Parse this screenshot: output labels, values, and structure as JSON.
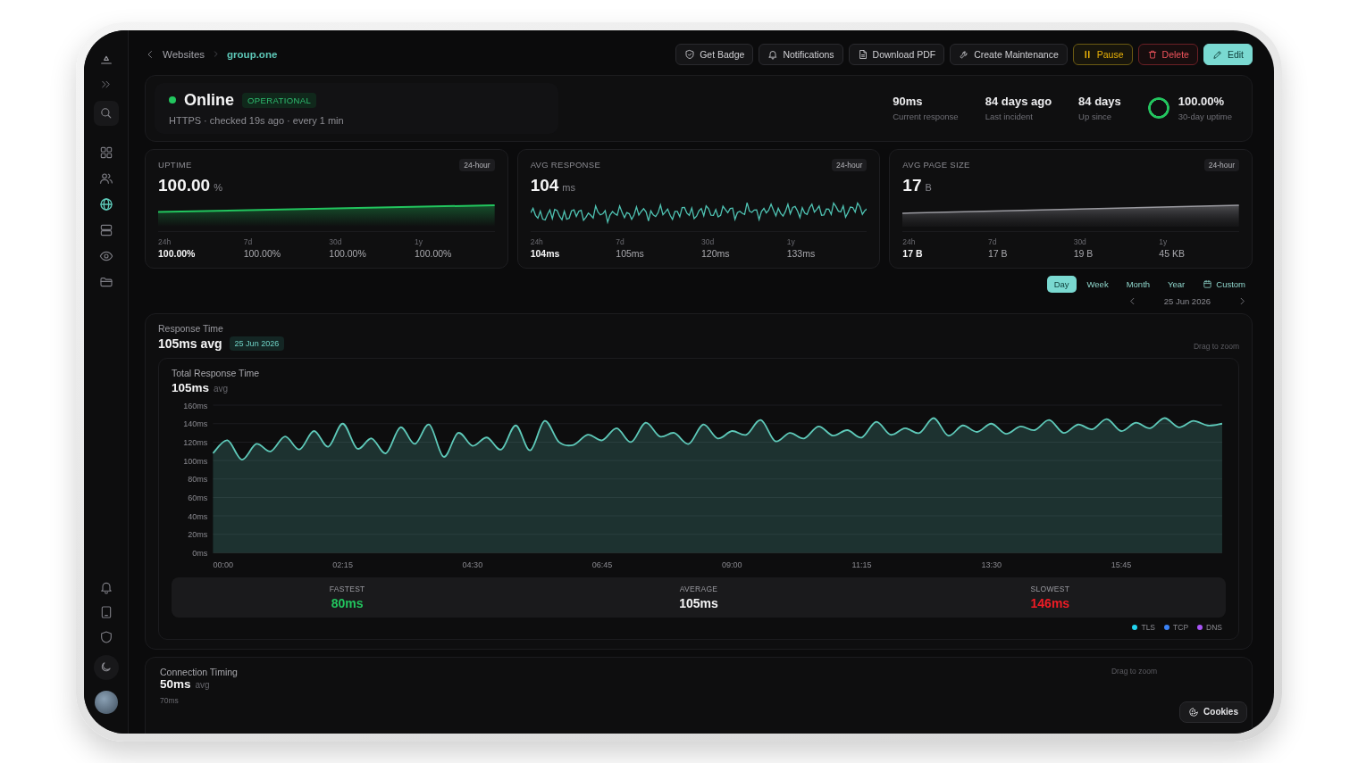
{
  "sidebar": {
    "nav": [
      {
        "selected": false
      },
      {
        "selected": false
      },
      {
        "selected": true
      },
      {
        "selected": false
      },
      {
        "selected": false
      },
      {
        "selected": false
      }
    ]
  },
  "breadcrumb": [
    {
      "label": "Websites",
      "current": false
    },
    {
      "label": "group.one",
      "current": true
    }
  ],
  "toolbar": [
    {
      "label": "Get Badge",
      "kind": "default"
    },
    {
      "label": "Notifications",
      "kind": "default"
    },
    {
      "label": "Download PDF",
      "kind": "default"
    },
    {
      "label": "Create Maintenance",
      "kind": "default"
    },
    {
      "label": "Pause",
      "kind": "warning"
    },
    {
      "label": "Delete",
      "kind": "danger"
    },
    {
      "label": "Edit",
      "kind": "primary"
    }
  ],
  "status": {
    "label": "Online",
    "online": true,
    "badge": "OPERATIONAL",
    "detail": "HTTPS · checked 19s ago · every 1 min"
  },
  "stats": [
    {
      "value": "90ms",
      "label": "Current response"
    },
    {
      "value": "84 days ago",
      "label": "Last incident"
    },
    {
      "value": "84 days",
      "label": "Up since"
    }
  ],
  "uptime_ring": {
    "value": "100.00%",
    "label": "30-day uptime",
    "level": 1
  },
  "cards": [
    {
      "kind": "uptime",
      "title": "UPTIME",
      "range": "24-hour",
      "value": "100.00",
      "unit": "%",
      "periods": [
        {
          "label": "24h",
          "value": "100.00%",
          "selected": true
        },
        {
          "label": "7d",
          "value": "100.00%",
          "selected": false
        },
        {
          "label": "30d",
          "value": "100.00%",
          "selected": false
        },
        {
          "label": "1y",
          "value": "100.00%",
          "selected": false
        }
      ]
    },
    {
      "kind": "response",
      "title": "AVG RESPONSE",
      "range": "24-hour",
      "value": "104",
      "unit": "ms",
      "periods": [
        {
          "label": "24h",
          "value": "104ms",
          "selected": true
        },
        {
          "label": "7d",
          "value": "105ms",
          "selected": false
        },
        {
          "label": "30d",
          "value": "120ms",
          "selected": false
        },
        {
          "label": "1y",
          "value": "133ms",
          "selected": false
        }
      ]
    },
    {
      "kind": "size",
      "title": "AVG PAGE SIZE",
      "range": "24-hour",
      "value": "17",
      "unit": "B",
      "periods": [
        {
          "label": "24h",
          "value": "17 B",
          "selected": true
        },
        {
          "label": "7d",
          "value": "17 B",
          "selected": false
        },
        {
          "label": "30d",
          "value": "19 B",
          "selected": false
        },
        {
          "label": "1y",
          "value": "45 KB",
          "selected": false
        }
      ]
    }
  ],
  "range_tabs": [
    {
      "label": "Day",
      "kind": "preset",
      "selected": true
    },
    {
      "label": "Week",
      "kind": "preset",
      "selected": false
    },
    {
      "label": "Month",
      "kind": "preset",
      "selected": false
    },
    {
      "label": "Year",
      "kind": "preset",
      "selected": false
    },
    {
      "label": "Custom",
      "kind": "custom",
      "selected": false
    }
  ],
  "date_nav": {
    "date": "25 Jun 2026"
  },
  "response_time": {
    "title": "Response Time",
    "value": "105ms avg",
    "date_badge": "25 Jun 2026",
    "hint": "Drag to zoom",
    "chart_value": "105ms",
    "chart_unit": "avg",
    "chart_data": {
      "type": "area",
      "title": "Total Response Time",
      "x": [
        0,
        15,
        30,
        45,
        60,
        75,
        90,
        105,
        120,
        135,
        150,
        165,
        180,
        195,
        210,
        225,
        240,
        255,
        270,
        285,
        300,
        315,
        330,
        345,
        360,
        375,
        390,
        405,
        420,
        435,
        450,
        465,
        480,
        495,
        510,
        525,
        540,
        555,
        570,
        585,
        600,
        615,
        630,
        645,
        660,
        675,
        690,
        705,
        720,
        735,
        750,
        765,
        780,
        795,
        810,
        825,
        840,
        855,
        870,
        885,
        900,
        915,
        930,
        945,
        960,
        975,
        990,
        1005,
        1020,
        1035,
        1050
      ],
      "series": [
        {
          "color": "#5ec9b9",
          "values": [
            108,
            122,
            101,
            118,
            110,
            126,
            112,
            132,
            115,
            140,
            113,
            124,
            108,
            136,
            118,
            139,
            104,
            130,
            116,
            125,
            112,
            138,
            111,
            143,
            120,
            117,
            128,
            122,
            135,
            120,
            141,
            126,
            130,
            118,
            139,
            124,
            132,
            128,
            144,
            121,
            130,
            124,
            137,
            127,
            133,
            125,
            142,
            128,
            135,
            130,
            146,
            127,
            138,
            131,
            140,
            129,
            137,
            133,
            144,
            130,
            139,
            134,
            145,
            132,
            141,
            135,
            146,
            136,
            143,
            138,
            140
          ]
        }
      ],
      "xlim": [
        0,
        1050
      ],
      "ylim": [
        0,
        160
      ],
      "grid": true,
      "xticks": [
        {
          "value": 0,
          "label": "00:00"
        },
        {
          "value": 135,
          "label": "02:15"
        },
        {
          "value": 270,
          "label": "04:30"
        },
        {
          "value": 405,
          "label": "06:45"
        },
        {
          "value": 540,
          "label": "09:00"
        },
        {
          "value": 675,
          "label": "11:15"
        },
        {
          "value": 810,
          "label": "13:30"
        },
        {
          "value": 945,
          "label": "15:45"
        }
      ],
      "yticks": [
        {
          "value": 0,
          "label": "0ms"
        },
        {
          "value": 20,
          "label": "20ms"
        },
        {
          "value": 40,
          "label": "40ms"
        },
        {
          "value": 60,
          "label": "60ms"
        },
        {
          "value": 80,
          "label": "80ms"
        },
        {
          "value": 100,
          "label": "100ms"
        },
        {
          "value": 120,
          "label": "120ms"
        },
        {
          "value": 140,
          "label": "140ms"
        },
        {
          "value": 160,
          "label": "160ms"
        }
      ]
    },
    "summary": [
      {
        "kind": "fastest",
        "label": "FASTEST",
        "value": "80ms"
      },
      {
        "kind": "average",
        "label": "AVERAGE",
        "value": "105ms"
      },
      {
        "kind": "slowest",
        "label": "SLOWEST",
        "value": "146ms"
      }
    ],
    "legend": [
      {
        "label": "TLS",
        "color": "#22d3ee"
      },
      {
        "label": "TCP",
        "color": "#3b82f6"
      },
      {
        "label": "DNS",
        "color": "#a855f7"
      }
    ]
  },
  "connection_timing": {
    "title": "Connection Timing",
    "value": "50ms",
    "unit": "avg",
    "hint": "Drag to zoom",
    "y_tick": "70ms"
  },
  "cookies_button": {
    "label": "Cookies"
  }
}
